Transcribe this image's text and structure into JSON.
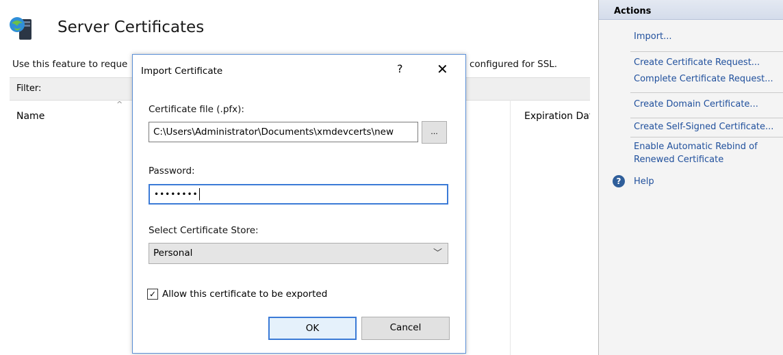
{
  "main": {
    "page_title": "Server Certificates",
    "description_left": "Use this feature to reque",
    "description_right": "configured for SSL.",
    "filter_label": "Filter:",
    "columns": {
      "name": "Name",
      "expiration": "Expiration Date"
    },
    "page_icon": "server-certificates-icon"
  },
  "actions": {
    "title": "Actions",
    "items": [
      "Import...",
      "Create Certificate Request...",
      "Complete Certificate Request...",
      "Create Domain Certificate...",
      "Create Self-Signed Certificate...",
      "Enable Automatic Rebind of",
      "Renewed Certificate",
      "Help"
    ],
    "link_color": "#1f4f9c"
  },
  "dialog": {
    "title": "Import Certificate",
    "help_glyph": "?",
    "close_glyph": "✕",
    "file_label": "Certificate file (.pfx):",
    "file_value": "C:\\Users\\Administrator\\Documents\\xmdevcerts\\new",
    "browse_label": "...",
    "password_label": "Password:",
    "password_value": "••••••••",
    "store_label": "Select Certificate Store:",
    "store_value": "Personal",
    "export_label": "Allow this certificate to be exported",
    "export_checked": true,
    "ok_label": "OK",
    "cancel_label": "Cancel",
    "accent": "#3a7ad6"
  }
}
